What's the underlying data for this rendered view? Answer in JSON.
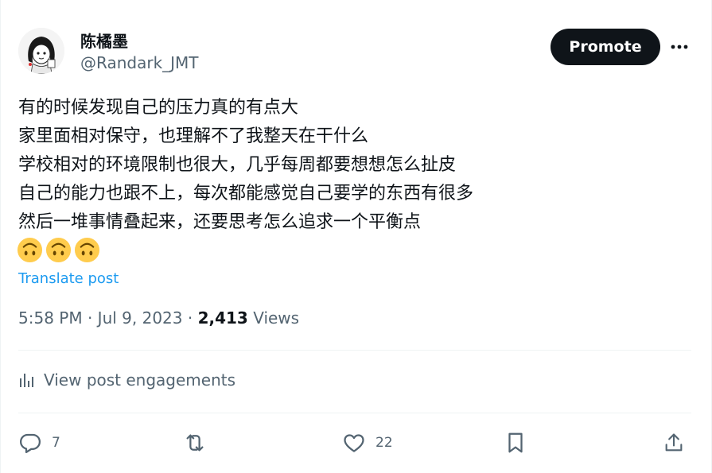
{
  "header": {
    "display_name": "陈橘墨",
    "handle": "@Randark_JMT",
    "promote_label": "Promote",
    "more_icon": "more-horizontal-icon"
  },
  "post": {
    "lines": [
      "有的时候发现自己的压力真的有点大",
      "家里面相对保守，也理解不了我整天在干什么",
      "学校相对的环境限制也很大，几乎每周都要想想怎么扯皮",
      "自己的能力也跟不上，每次都能感觉自己要学的东西有很多",
      "然后一堆事情叠起来，还要思考怎么追求一个平衡点"
    ],
    "emoji_count": 3,
    "emoji": "upside-down-face-emoji",
    "translate_label": "Translate post"
  },
  "meta": {
    "time": "5:58 PM",
    "separator": "·",
    "date": "Jul 9, 2023",
    "views_count": "2,413",
    "views_label": "Views"
  },
  "engagements": {
    "label": "View post engagements",
    "icon": "analytics-icon"
  },
  "actions": {
    "replies": "7",
    "retweets": "",
    "likes": "22"
  },
  "colors": {
    "text": "#0f1419",
    "secondary": "#536471",
    "link": "#1d9bf0",
    "button": "#0f1419",
    "divider": "#eff3f4"
  }
}
